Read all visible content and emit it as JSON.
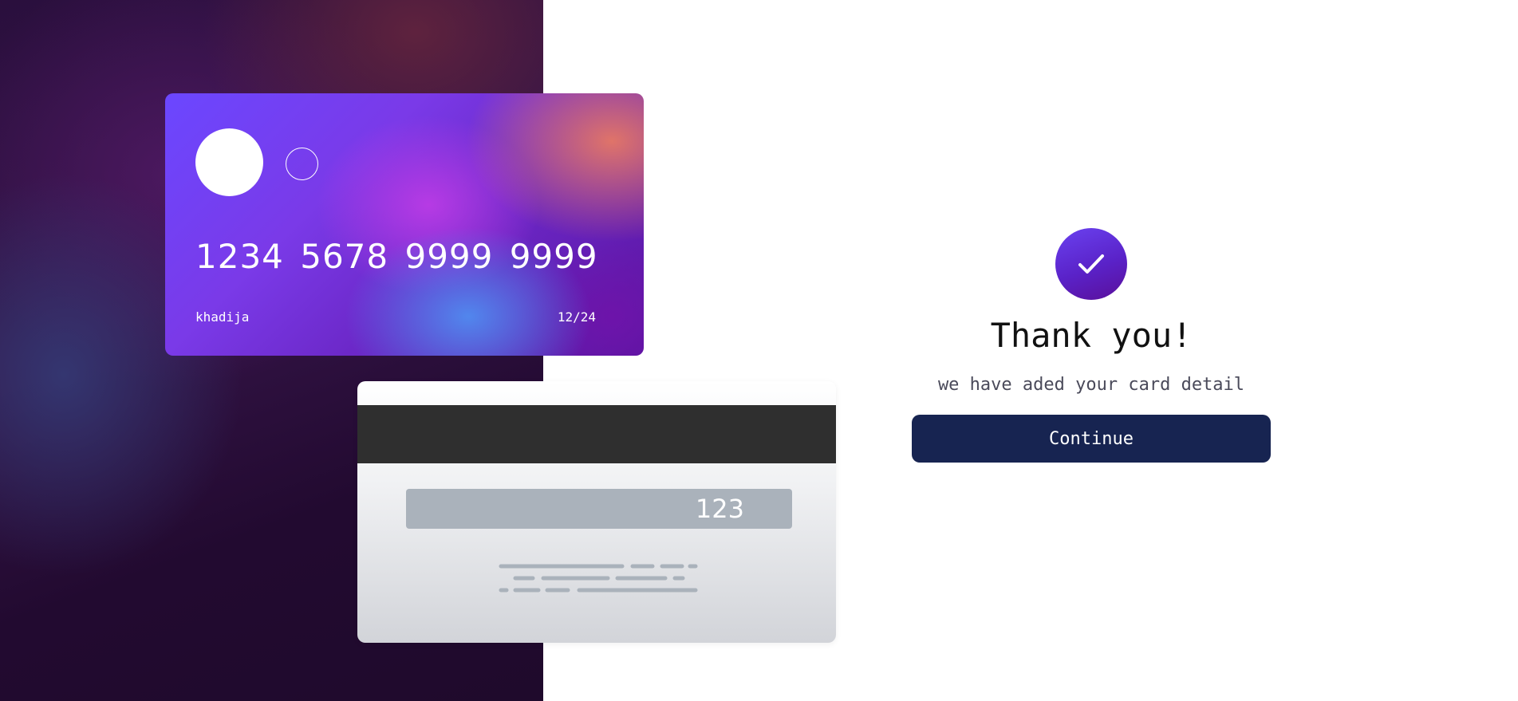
{
  "card_front": {
    "number": "1234 5678 9999 9999",
    "name": "khadija",
    "expiry": "12/24"
  },
  "card_back": {
    "cvc": "123"
  },
  "confirmation": {
    "title": "Thank you!",
    "message": "we have aded your card detail",
    "button_label": "Continue",
    "icon": "check-icon"
  },
  "colors": {
    "button_bg": "#172451",
    "accent_start": "#6a42f0",
    "accent_end": "#5a0f9a",
    "left_bg": "#220a30"
  }
}
